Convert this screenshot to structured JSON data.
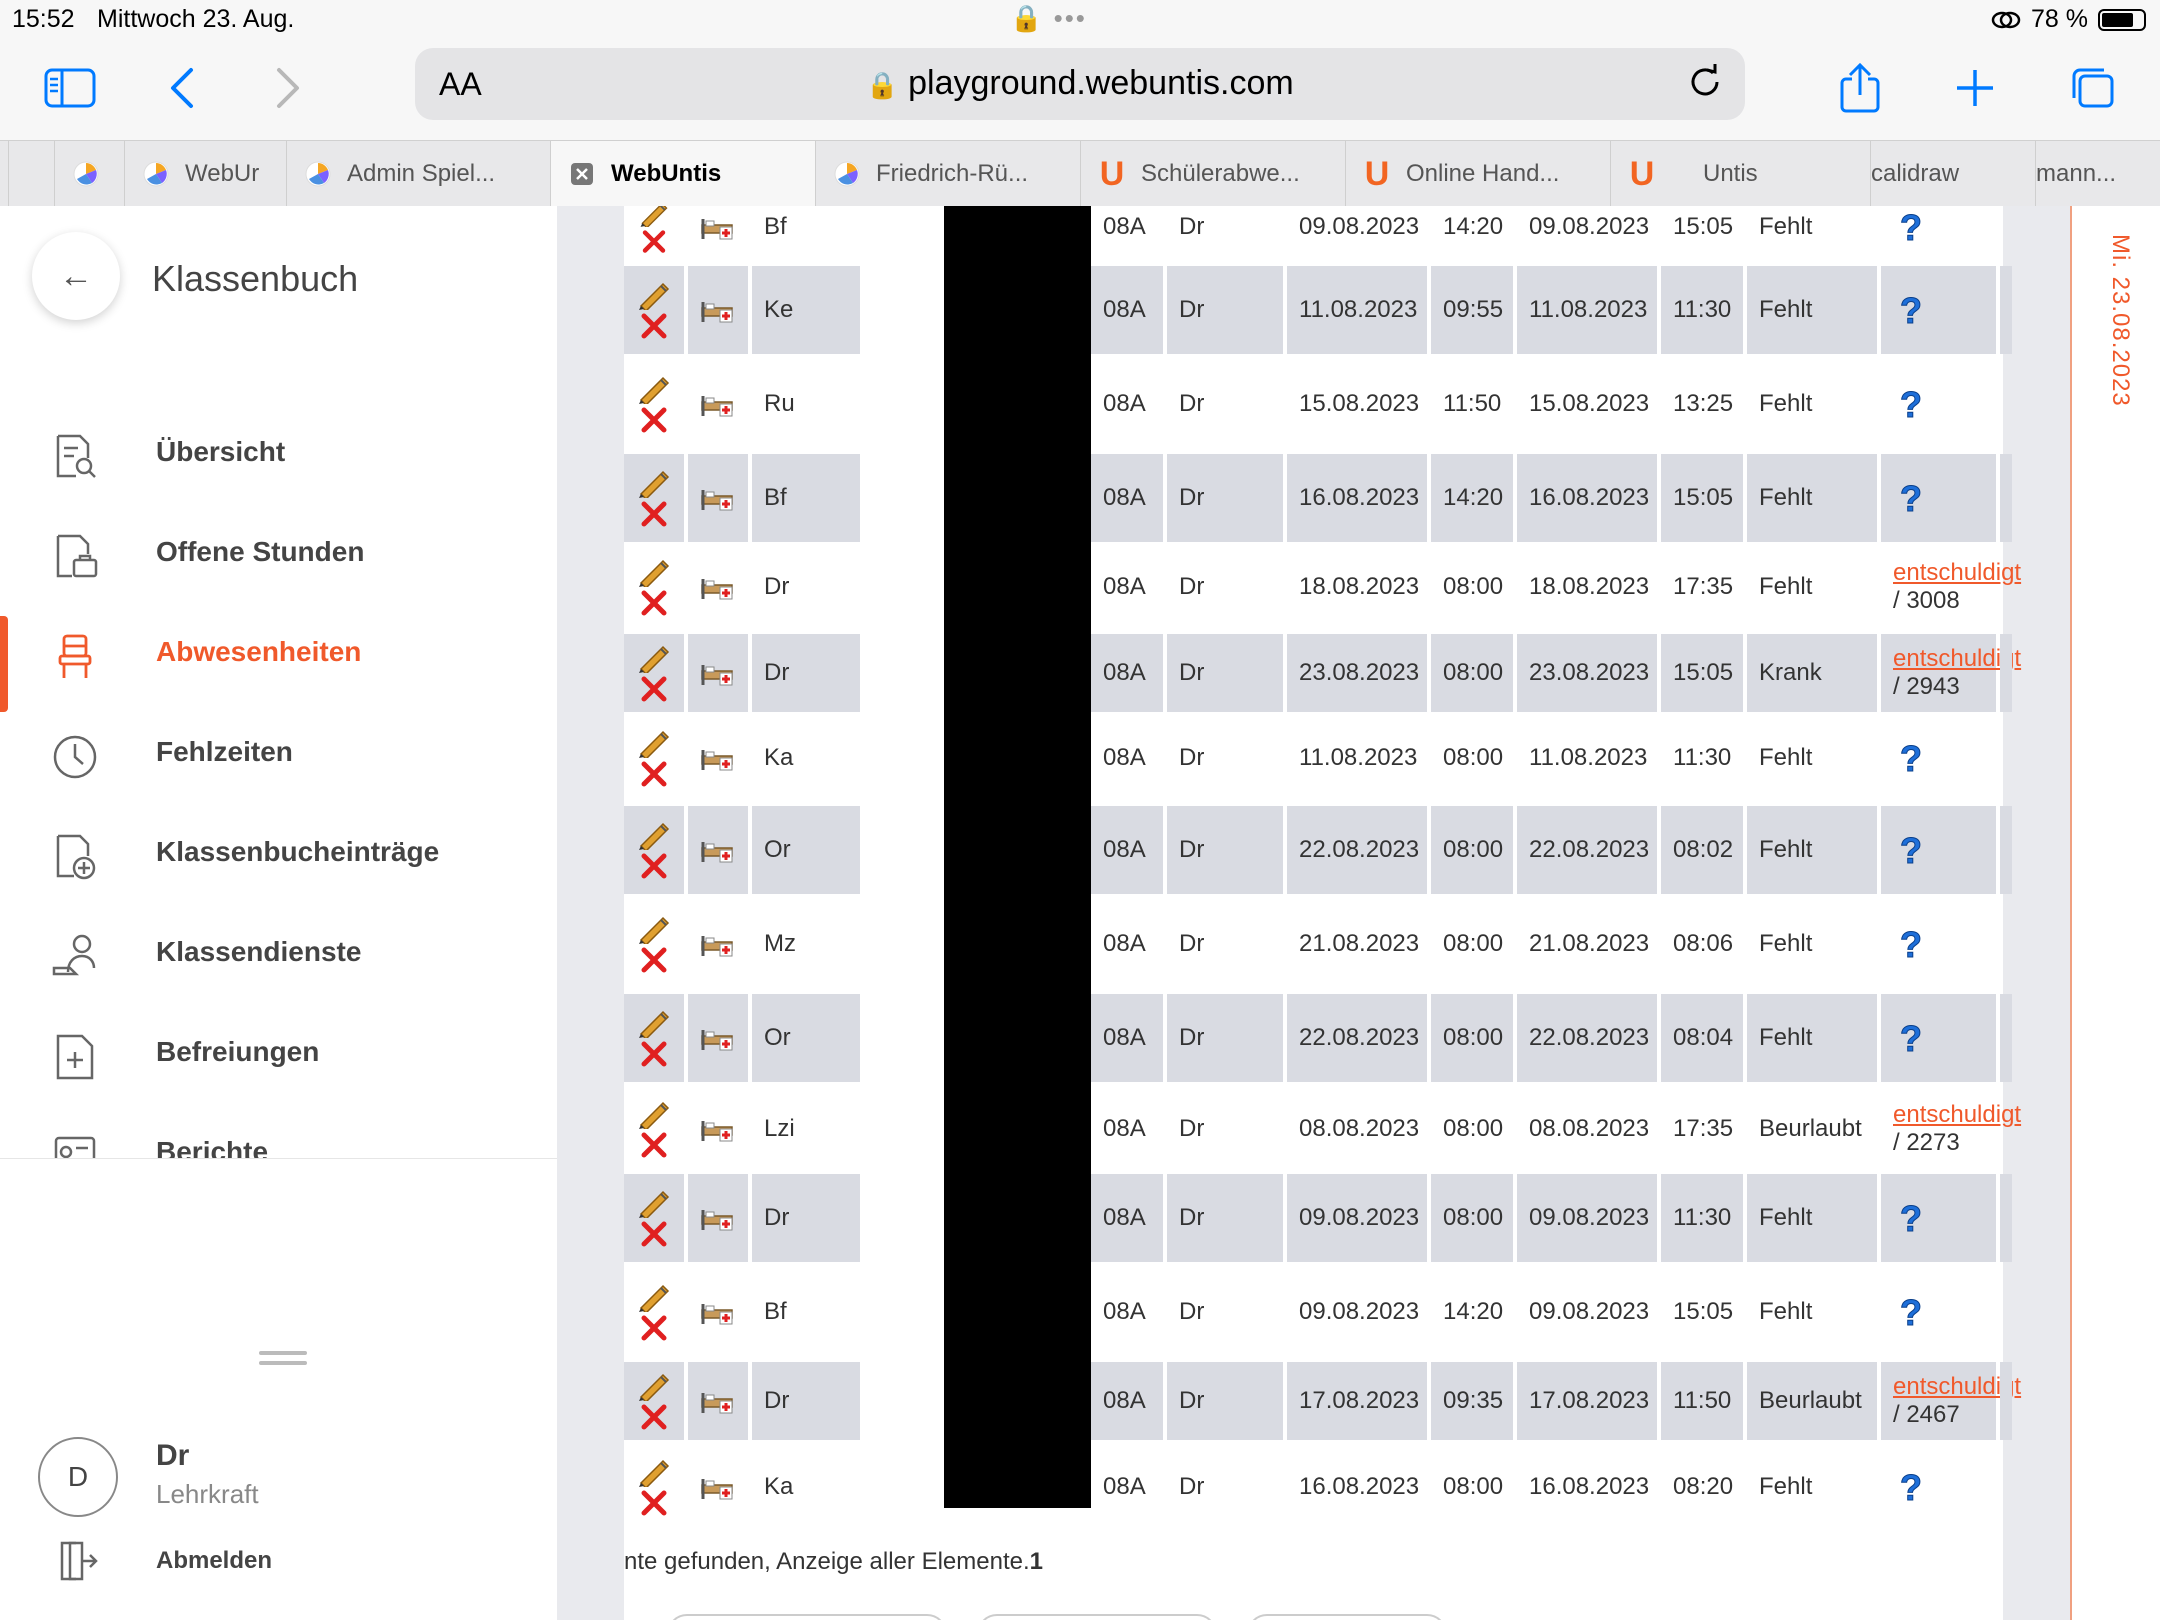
{
  "status_bar": {
    "time": "15:52",
    "date": "Mittwoch 23. Aug.",
    "battery": "78 %",
    "battery_level": 0.78
  },
  "browser": {
    "url": "playground.webuntis.com",
    "aa_label": "AA"
  },
  "tabs": [
    {
      "label": "",
      "icon": "untis-clock-icon"
    },
    {
      "label": "WebUr",
      "icon": "untis-clock-icon"
    },
    {
      "label": "Admin Spiel...",
      "icon": "untis-clock-icon"
    },
    {
      "label": "WebUntis",
      "icon": "close-icon",
      "active": true
    },
    {
      "label": "Friedrich-Rü...",
      "icon": "untis-clock-icon"
    },
    {
      "label": "Schülerabwe...",
      "icon": "untis-u-icon"
    },
    {
      "label": "Online Hand...",
      "icon": "untis-u-icon"
    },
    {
      "label": "Untis",
      "icon": "untis-u-icon"
    },
    {
      "label": "calidraw",
      "icon": ""
    },
    {
      "label": "mann...",
      "icon": ""
    }
  ],
  "sidebar": {
    "title": "Klassenbuch",
    "items": [
      {
        "label": "Übersicht",
        "icon": "overview-icon"
      },
      {
        "label": "Offene Stunden",
        "icon": "open-lessons-icon"
      },
      {
        "label": "Abwesenheiten",
        "icon": "chair-icon",
        "active": true
      },
      {
        "label": "Fehlzeiten",
        "icon": "clock-icon"
      },
      {
        "label": "Klassenbucheinträge",
        "icon": "add-entry-icon"
      },
      {
        "label": "Klassendienste",
        "icon": "class-duty-icon"
      },
      {
        "label": "Befreiungen",
        "icon": "exemption-icon"
      },
      {
        "label": "Berichte",
        "icon": "reports-icon"
      }
    ],
    "user": {
      "initial": "D",
      "name": "Dr",
      "role": "Lehrkraft",
      "logout": "Abmelden"
    }
  },
  "right_date": "Mi. 23.08.2023",
  "table": {
    "rows": [
      {
        "teacher": "Bf",
        "class": "08A",
        "entered_by": "Dr",
        "from_date": "09.08.2023",
        "from_time": "14:20",
        "to_date": "09.08.2023",
        "to_time": "15:05",
        "reason": "Fehlt",
        "status": "?",
        "status_num": ""
      },
      {
        "teacher": "Ke",
        "class": "08A",
        "entered_by": "Dr",
        "from_date": "11.08.2023",
        "from_time": "09:55",
        "to_date": "11.08.2023",
        "to_time": "11:30",
        "reason": "Fehlt",
        "status": "?",
        "status_num": ""
      },
      {
        "teacher": "Ru",
        "class": "08A",
        "entered_by": "Dr",
        "from_date": "15.08.2023",
        "from_time": "11:50",
        "to_date": "15.08.2023",
        "to_time": "13:25",
        "reason": "Fehlt",
        "status": "?",
        "status_num": ""
      },
      {
        "teacher": "Bf",
        "class": "08A",
        "entered_by": "Dr",
        "from_date": "16.08.2023",
        "from_time": "14:20",
        "to_date": "16.08.2023",
        "to_time": "15:05",
        "reason": "Fehlt",
        "status": "?",
        "status_num": ""
      },
      {
        "teacher": "Dr",
        "class": "08A",
        "entered_by": "Dr",
        "from_date": "18.08.2023",
        "from_time": "08:00",
        "to_date": "18.08.2023",
        "to_time": "17:35",
        "reason": "Fehlt",
        "status": "entschuldigt",
        "status_num": "/ 3008"
      },
      {
        "teacher": "Dr",
        "class": "08A",
        "entered_by": "Dr",
        "from_date": "23.08.2023",
        "from_time": "08:00",
        "to_date": "23.08.2023",
        "to_time": "15:05",
        "reason": "Krank",
        "status": "entschuldigt",
        "status_num": "/ 2943"
      },
      {
        "teacher": "Ka",
        "class": "08A",
        "entered_by": "Dr",
        "from_date": "11.08.2023",
        "from_time": "08:00",
        "to_date": "11.08.2023",
        "to_time": "11:30",
        "reason": "Fehlt",
        "status": "?",
        "status_num": ""
      },
      {
        "teacher": "Or",
        "class": "08A",
        "entered_by": "Dr",
        "from_date": "22.08.2023",
        "from_time": "08:00",
        "to_date": "22.08.2023",
        "to_time": "08:02",
        "reason": "Fehlt",
        "status": "?",
        "status_num": ""
      },
      {
        "teacher": "Mz",
        "class": "08A",
        "entered_by": "Dr",
        "from_date": "21.08.2023",
        "from_time": "08:00",
        "to_date": "21.08.2023",
        "to_time": "08:06",
        "reason": "Fehlt",
        "status": "?",
        "status_num": ""
      },
      {
        "teacher": "Or",
        "class": "08A",
        "entered_by": "Dr",
        "from_date": "22.08.2023",
        "from_time": "08:00",
        "to_date": "22.08.2023",
        "to_time": "08:04",
        "reason": "Fehlt",
        "status": "?",
        "status_num": ""
      },
      {
        "teacher": "Lzi",
        "class": "08A",
        "entered_by": "Dr",
        "from_date": "08.08.2023",
        "from_time": "08:00",
        "to_date": "08.08.2023",
        "to_time": "17:35",
        "reason": "Beurlaubt",
        "status": "entschuldigt",
        "status_num": "/ 2273"
      },
      {
        "teacher": "Dr",
        "class": "08A",
        "entered_by": "Dr",
        "from_date": "09.08.2023",
        "from_time": "08:00",
        "to_date": "09.08.2023",
        "to_time": "11:30",
        "reason": "Fehlt",
        "status": "?",
        "status_num": ""
      },
      {
        "teacher": "Bf",
        "class": "08A",
        "entered_by": "Dr",
        "from_date": "09.08.2023",
        "from_time": "14:20",
        "to_date": "09.08.2023",
        "to_time": "15:05",
        "reason": "Fehlt",
        "status": "?",
        "status_num": ""
      },
      {
        "teacher": "Dr",
        "class": "08A",
        "entered_by": "Dr",
        "from_date": "17.08.2023",
        "from_time": "09:35",
        "to_date": "17.08.2023",
        "to_time": "11:50",
        "reason": "Beurlaubt",
        "status": "entschuldigt",
        "status_num": "/ 2467"
      },
      {
        "teacher": "Ka",
        "class": "08A",
        "entered_by": "Dr",
        "from_date": "16.08.2023",
        "from_time": "08:00",
        "to_date": "16.08.2023",
        "to_time": "08:20",
        "reason": "Fehlt",
        "status": "?",
        "status_num": ""
      }
    ],
    "footer_text": "nte gefunden, Anzeige aller Elemente.",
    "footer_count": "1"
  },
  "colors": {
    "accent": "#f0592b",
    "row_shade": "#d9dbe2",
    "link_blue": "#007aff"
  }
}
